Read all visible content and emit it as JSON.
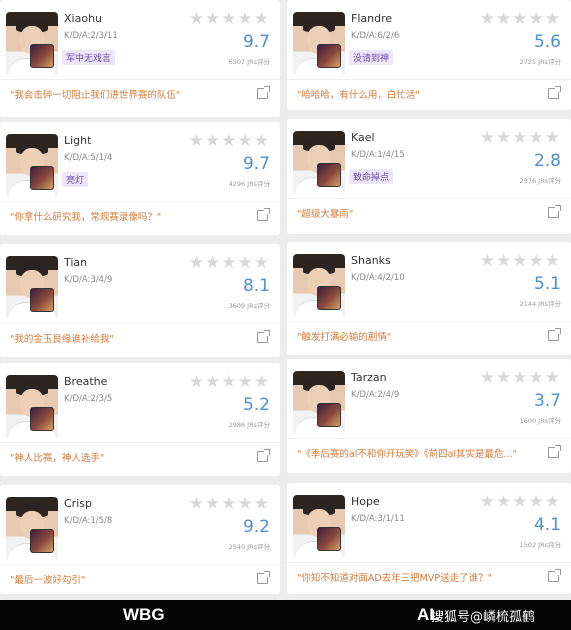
{
  "left": [
    {
      "name": "Xiaohu",
      "kda": "K/D/A:2/3/11",
      "tag": "军中无戏言",
      "stars": "★★★★★",
      "score": "9.7",
      "votes": "6507 JRs评分",
      "quote": "\"我会击碎一切阻止我们进世界赛的队伍\""
    },
    {
      "name": "Light",
      "kda": "K/D/A:5/1/4",
      "tag": "亮灯",
      "stars": "★★★★★",
      "score": "9.7",
      "votes": "4296 JRs评分",
      "quote": "\"你拿什么研究我，常规赛录像吗？\""
    },
    {
      "name": "Tian",
      "kda": "K/D/A:3/4/9",
      "tag": "",
      "stars": "★★★★★",
      "score": "8.1",
      "votes": "3609 JRs评分",
      "quote": "\"我的金玉良缘谁补给我\""
    },
    {
      "name": "Breathe",
      "kda": "K/D/A:2/3/5",
      "tag": "",
      "stars": "★★★★★",
      "score": "5.2",
      "votes": "2986 JRs评分",
      "quote": "\"神人比赛，神人选手\""
    },
    {
      "name": "Crisp",
      "kda": "K/D/A:1/5/8",
      "tag": "",
      "stars": "★★★★★",
      "score": "9.2",
      "votes": "2540 JRs评分",
      "quote": "\"最后一波好勾引\""
    }
  ],
  "right": [
    {
      "name": "Flandre",
      "kda": "K/D/A:6/2/6",
      "tag": "没请到神",
      "stars": "★★★★★",
      "score": "5.6",
      "votes": "2725 JRs评分",
      "quote": "\"哈哈哈，有什么用，白忙活\""
    },
    {
      "name": "Kael",
      "kda": "K/D/A:1/4/15",
      "tag": "致命掉点",
      "stars": "★★★★★",
      "score": "2.8",
      "votes": "2376 JRs评分",
      "quote": "\"超级大暴雨\""
    },
    {
      "name": "Shanks",
      "kda": "K/D/A:4/2/10",
      "tag": "",
      "stars": "★★★★★",
      "score": "5.1",
      "votes": "2144 JRs评分",
      "quote": "\"触发打满必输的剧情\""
    },
    {
      "name": "Tarzan",
      "kda": "K/D/A:2/4/9",
      "tag": "",
      "stars": "★★★★★",
      "score": "3.7",
      "votes": "1600 JRs评分",
      "quote": "\"《季后赛的al不和你开玩笑》《前四al其实是最危...\""
    },
    {
      "name": "Hope",
      "kda": "K/D/A:3/1/11",
      "tag": "",
      "stars": "★★★★★",
      "score": "4.1",
      "votes": "1502 JRs评分",
      "quote": "\"你知不知道对面AD去年三把MVP送走了谁？\""
    }
  ],
  "footer": {
    "left_team": "WBG",
    "right_team": "AL",
    "watermark": "搜狐号@嶙梳孤鹤"
  },
  "colors": {
    "score": "#4d90cf",
    "quote": "#d47a3a",
    "tag_text": "#6a4db0",
    "tag_bg": "#ece6f8",
    "star_empty": "#d8d8d8"
  }
}
